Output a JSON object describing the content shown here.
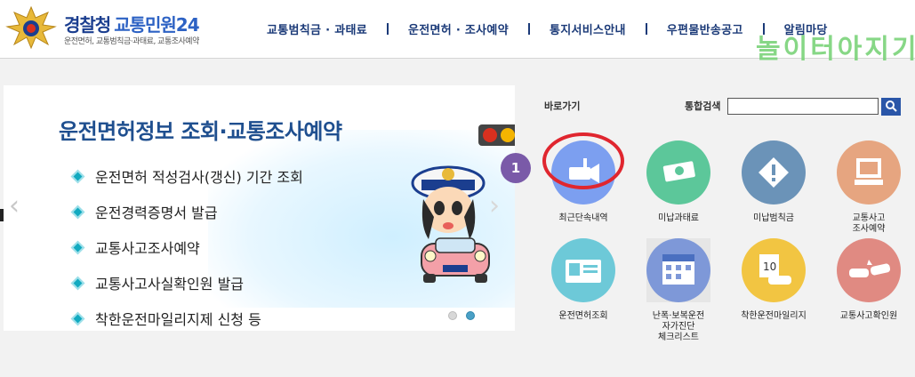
{
  "header": {
    "logo_main": "경찰청",
    "logo_sub_title": "교통민원24",
    "logo_tagline": "운전면허, 교통범칙금·과태료, 교통조사예약",
    "nav": [
      "교통범칙금 · 과태료",
      "운전면허 · 조사예약",
      "통지서비스안내",
      "우편물반송공고",
      "알림마당"
    ],
    "watermark": "놀이터아지기"
  },
  "banner": {
    "title": "운전면허정보 조회·교통조사예약",
    "items": [
      "운전면허 적성검사(갱신) 기간 조회",
      "운전경력증명서 발급",
      "교통사고조사예약",
      "교통사고사실확인원 발급",
      "착한운전마일리지제 신청 등"
    ],
    "active_slide": 2,
    "slide_count": 2
  },
  "panel": {
    "shortcut_label": "바로가기",
    "search_label": "통합검색",
    "search_value": "",
    "badge": "1",
    "tiles": [
      {
        "label": "최근단속내역",
        "icon": "camera-icon",
        "color": "#7c9ff0"
      },
      {
        "label": "미납과태료",
        "icon": "money-icon",
        "color": "#5cc79a"
      },
      {
        "label": "미납범칙금",
        "icon": "warning-icon",
        "color": "#6b93b8"
      },
      {
        "label": "교통사고\n조사예약",
        "icon": "computer-icon",
        "color": "#e6a580"
      },
      {
        "label": "운전면허조회",
        "icon": "id-card-icon",
        "color": "#6dc9d8"
      },
      {
        "label": "난폭·보복운전\n자가진단\n체크리스트",
        "icon": "calendar-icon",
        "color": "#7e98d8"
      },
      {
        "label": "착한운전마일리지",
        "icon": "mileage-icon",
        "color": "#f2c542"
      },
      {
        "label": "교통사고확인원",
        "icon": "crash-icon",
        "color": "#e08a82"
      }
    ]
  }
}
